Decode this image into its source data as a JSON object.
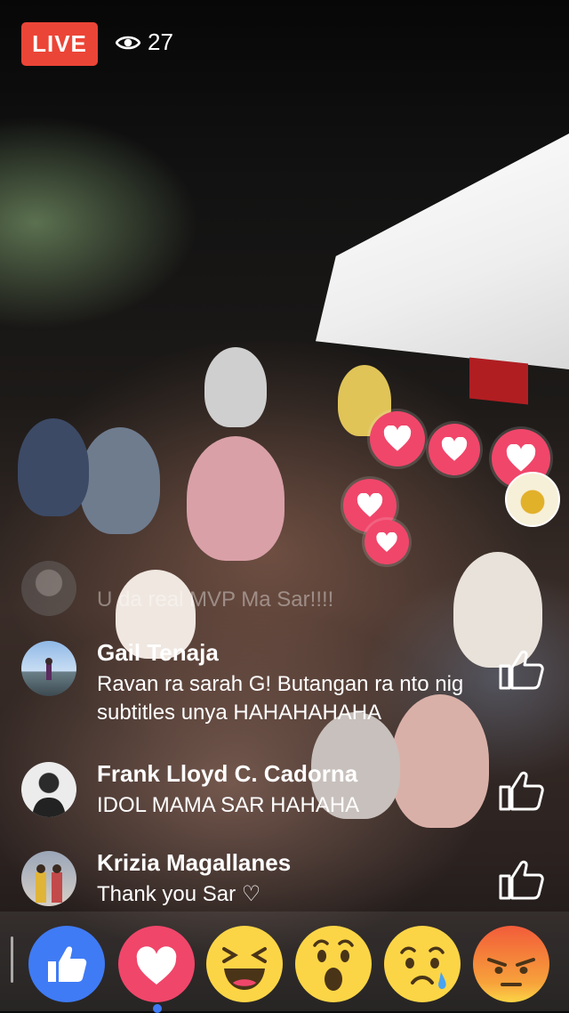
{
  "header": {
    "live_label": "LIVE",
    "viewer_count": "27",
    "viewer_icon": "eye-icon"
  },
  "comments": [
    {
      "name": "",
      "text": "U da real MVP Ma Sar!!!!",
      "faded": true
    },
    {
      "name": "Gail Tenaja",
      "text": "Ravan ra sarah G! Butangan ra nto nig subtitles unya HAHAHAHAHA"
    },
    {
      "name": "Frank Lloyd C. Cadorna",
      "text": "IDOL MAMA SAR HAHAHA"
    },
    {
      "name": "Krizia Magallanes",
      "text": "Thank you Sar ♡"
    }
  ],
  "reactions": [
    "like",
    "love",
    "haha",
    "wow",
    "sad",
    "angry"
  ],
  "selected_reaction": "love",
  "colors": {
    "live_red": "#eb4537",
    "heart_pink": "#f0466a",
    "like_blue": "#3f7bf5",
    "emoji_yellow": "#fcd546",
    "angry_red": "#f25c3a"
  }
}
